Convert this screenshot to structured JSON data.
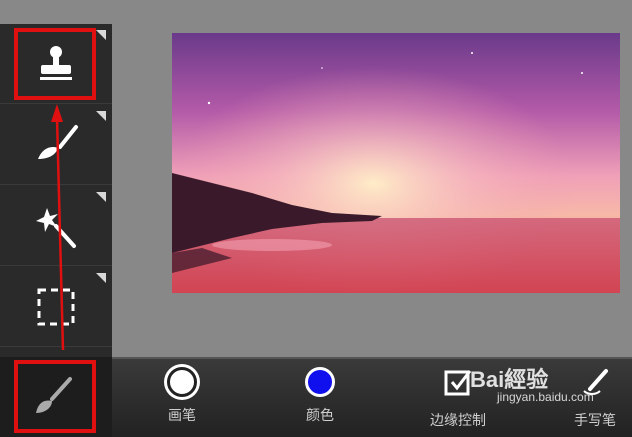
{
  "sidebar": {
    "tools": [
      {
        "name": "stamp-tool",
        "icon": "stamp-icon"
      },
      {
        "name": "smudge-brush-tool",
        "icon": "smudge-brush-icon"
      },
      {
        "name": "magic-wand-tool",
        "icon": "magic-wand-icon"
      },
      {
        "name": "selection-tool",
        "icon": "dashed-selection-icon"
      }
    ],
    "active_tool_icon": "paint-brush-icon"
  },
  "canvas": {
    "image": "sunset-over-sea-photo"
  },
  "bottom_bar": {
    "items": [
      {
        "label": "画笔",
        "icon": "brush-circle-icon",
        "color": "#ffffff"
      },
      {
        "label": "颜色",
        "icon": "color-swatch-icon",
        "color": "#1010ee"
      },
      {
        "label": "边缘控制",
        "icon": "checkbox-icon"
      },
      {
        "label": "手写笔",
        "icon": "stylus-icon"
      }
    ]
  },
  "watermark": {
    "text": "Bai經验",
    "sub": "jingyan.baidu.com"
  },
  "highlight_color": "#e01010"
}
